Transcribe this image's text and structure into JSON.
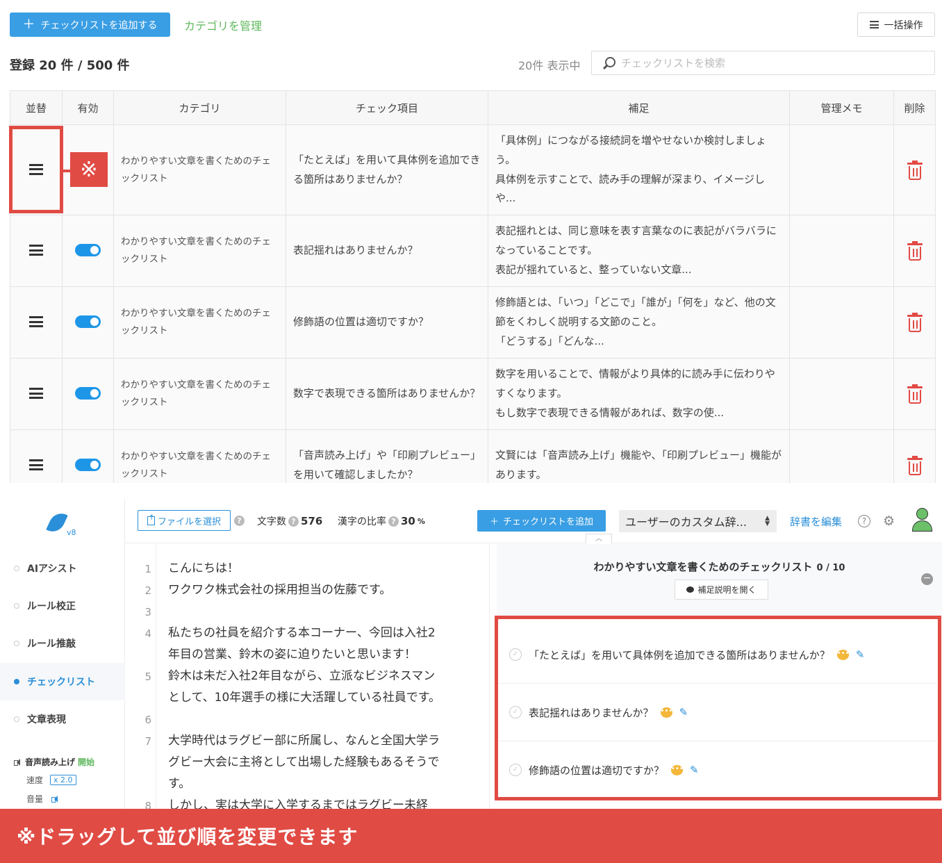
{
  "top": {
    "add_checklist_label": "チェックリストを追加する",
    "manage_category_label": "カテゴリを管理",
    "bulk_label": "一括操作",
    "registered": "登録 20 件 / 500 件",
    "shown": "20件 表示中",
    "search_placeholder": "チェックリストを検索",
    "columns": [
      "並替",
      "有効",
      "カテゴリ",
      "チェック項目",
      "補足",
      "管理メモ",
      "削除"
    ],
    "rows": [
      {
        "category": "わかりやすい文章を書くためのチェックリスト",
        "item": "「たとえば」を用いて具体例を追加できる箇所はありませんか？",
        "note": "「具体例」につながる接続詞を増やせないか検討しましょう。\n具体例を示すことで、読み手の理解が深まり、イメージしや..."
      },
      {
        "category": "わかりやすい文章を書くためのチェックリスト",
        "item": "表記揺れはありませんか？",
        "note": "表記揺れとは、同じ意味を表す言葉なのに表記がバラバラになっていることです。\n表記が揺れていると、整っていない文章..."
      },
      {
        "category": "わかりやすい文章を書くためのチェックリスト",
        "item": "修飾語の位置は適切ですか？",
        "note": "修飾語とは、「いつ」「どこで」「誰が」「何を」など、他の文節をくわしく説明する文節のこと。\n「どうする」「どんな..."
      },
      {
        "category": "わかりやすい文章を書くためのチェックリスト",
        "item": "数字で表現できる箇所はありませんか？",
        "note": "数字を用いることで、情報がより具体的に読み手に伝わりやすくなります。\nもし数字で表現できる情報があれば、数字の使..."
      },
      {
        "category": "わかりやすい文章を書くためのチェックリスト",
        "item": "「音声読み上げ」や「印刷プレビュー」を用いて確認しましたか？",
        "note": "文賢には「音声読み上げ」機能や、「印刷プレビュー」機能があります。"
      }
    ],
    "callout_mark": "※"
  },
  "app": {
    "version": "v8",
    "nav": [
      {
        "label": "AIアシスト",
        "active": false
      },
      {
        "label": "ルール校正",
        "active": false
      },
      {
        "label": "ルール推敲",
        "active": false
      },
      {
        "label": "チェックリスト",
        "active": true
      },
      {
        "label": "文章表現",
        "active": false
      }
    ],
    "tts_label": "音声読み上げ",
    "tts_start": "開始",
    "speed_label": "速度",
    "speed_value": "x 2.0",
    "volume_label": "音量",
    "file_btn": "ファイルを選択",
    "char_count_label": "文字数",
    "char_count": "576",
    "kanji_label": "漢字の比率",
    "kanji_value": "30",
    "kanji_unit": "%",
    "add_checklist": "チェックリストを追加",
    "dictionary": "ユーザーのカスタム辞...",
    "edit_dictionary": "辞書を編集",
    "lines": [
      {
        "n": "1",
        "text": "こんにちは！"
      },
      {
        "n": "2",
        "text": "ワクワク株式会社の採用担当の佐藤です。"
      },
      {
        "n": "3",
        "text": ""
      },
      {
        "n": "4",
        "text": "私たちの社員を紹介する本コーナー、今回は入社2"
      },
      {
        "n": "",
        "text": "年目の営業、鈴木の姿に迫りたいと思います！"
      },
      {
        "n": "5",
        "text": "鈴木は未だ入社2年目ながら、立派なビジネスマン"
      },
      {
        "n": "",
        "text": "として、10年選手の様に大活躍している社員です。"
      },
      {
        "n": "6",
        "text": ""
      },
      {
        "n": "7",
        "text": "大学時代はラグビー部に所属し、なんと全国大学ラ"
      },
      {
        "n": "",
        "text": "グビー大会に主将として出場した経験もあるそうで"
      },
      {
        "n": "",
        "text": "す。"
      },
      {
        "n": "8",
        "text": "しかし、実は大学に入学するまではラグビー未経"
      }
    ],
    "checklist_title": "わかりやすい文章を書くためのチェックリスト",
    "checklist_count": "0 / 10",
    "open_notes": "補足説明を開く",
    "checklist_items": [
      "「たとえば」を用いて具体例を追加できる箇所はありませんか？",
      "表記揺れはありませんか？",
      "修飾語の位置は適切ですか？"
    ]
  },
  "banner": "※ドラッグして並び順を変更できます",
  "colors": {
    "accent": "#3a9ee4",
    "red": "#e04b44",
    "green": "#5db85c"
  }
}
